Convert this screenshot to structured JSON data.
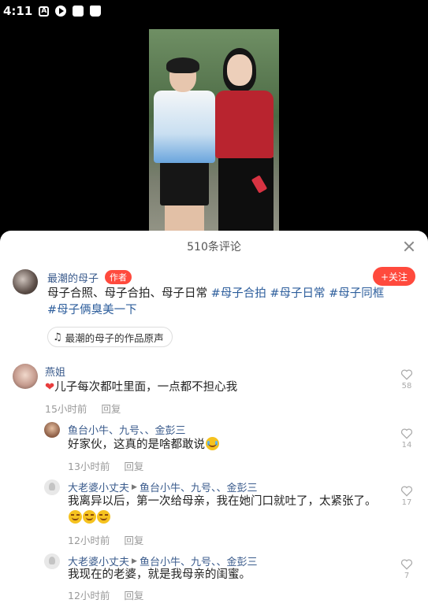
{
  "status_bar": {
    "time": "4:11",
    "icons": [
      "a-icon",
      "play-icon",
      "mail-icon",
      "bag-icon"
    ]
  },
  "sheet": {
    "title": "510条评论"
  },
  "author_post": {
    "name": "最潮的母子",
    "tag": "作者",
    "follow_label": "+关注",
    "caption_plain": "母子合照、母子合拍、母子日常 ",
    "hashtags": [
      "#母子合拍",
      "#母子日常",
      "#母子同框",
      "#母子俩臭美一下"
    ],
    "music_label": "最潮的母子的作品原声"
  },
  "comments": [
    {
      "name": "燕姐",
      "text": "儿子每次都吐里面，一点都不担心我",
      "time": "15小时前",
      "reply": "回复",
      "likes": "58",
      "replies": [
        {
          "name": "鱼台小牛、九号、、金彭三",
          "text": "好家伙，这真的是啥都敢说",
          "time": "13小时前",
          "reply": "回复",
          "likes": "14"
        },
        {
          "name": "大老婆小丈夫",
          "to": "鱼台小牛、九号、、金彭三",
          "text": "我离异以后，第一次给母亲，我在她门口就吐了，太紧张了。",
          "time": "12小时前",
          "reply": "回复",
          "likes": "17"
        },
        {
          "name": "大老婆小丈夫",
          "to": "鱼台小牛、九号、、金彭三",
          "text": "我现在的老婆，就是我母亲的闺蜜。",
          "time": "12小时前",
          "reply": "回复",
          "likes": "7"
        }
      ]
    }
  ],
  "colors": {
    "accent": "#ff4a3d",
    "link": "#3a5b8c",
    "hashtag": "#2d5e9c"
  }
}
